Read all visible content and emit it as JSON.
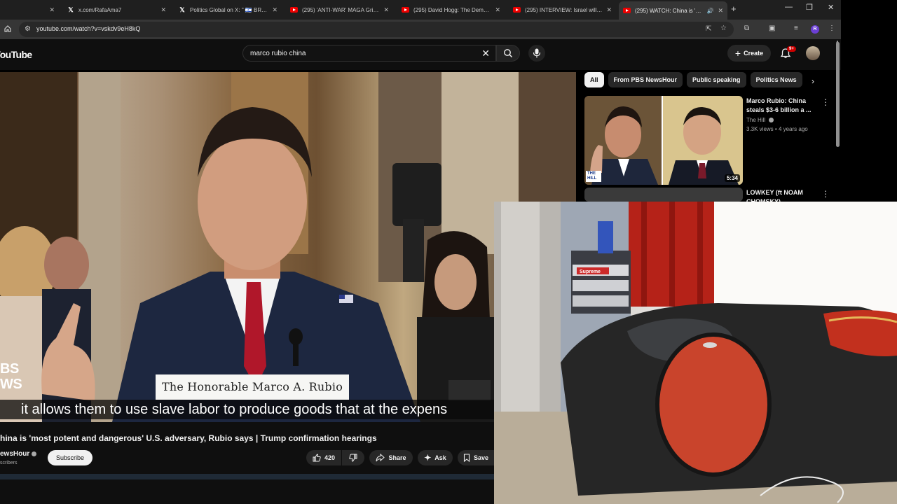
{
  "browser": {
    "tabs": [
      {
        "title": "",
        "icon": "blank-icon",
        "active": false
      },
      {
        "title": "x.com/RafaAma7",
        "icon": "x-logo-icon",
        "active": false
      },
      {
        "title": "Politics Global on X: \" 🇮🇱 BRE…",
        "icon": "x-logo-icon",
        "active": false
      },
      {
        "title": "(295) 'ANTI-WAR' MAGA Grifte…",
        "icon": "youtube-icon",
        "active": false
      },
      {
        "title": "(295) David Hogg: The Democ…",
        "icon": "youtube-icon",
        "active": false
      },
      {
        "title": "(295) INTERVIEW: Israel will ac…",
        "icon": "youtube-icon",
        "active": false
      },
      {
        "title": "(295) WATCH: China is 'mo…",
        "icon": "youtube-icon",
        "active": true
      }
    ],
    "url": "youtube.com/watch?v=vskdv9eH8kQ",
    "profile_initial": "R"
  },
  "youtube": {
    "logo_text": "YouTube",
    "search_query": "marco rubio china",
    "create_label": "Create",
    "notification_badge": "9+"
  },
  "video": {
    "lower_third": "The Honorable Marco A. Rubio",
    "subtitle": "it allows them to use slave labor to produce goods that at the expens",
    "network_bug": "BS\nWS",
    "title": "hina is 'most potent and dangerous' U.S. adversary, Rubio says | Trump confirmation hearings",
    "channel": "ewsHour",
    "subscribers": "scribers",
    "subscribe_label": "Subscribe",
    "likes": "420",
    "share_label": "Share",
    "ask_label": "Ask",
    "save_label": "Save"
  },
  "sidebar": {
    "chips": [
      {
        "label": "All",
        "active": true
      },
      {
        "label": "From PBS NewsHour",
        "active": false
      },
      {
        "label": "Public speaking",
        "active": false
      },
      {
        "label": "Politics News",
        "active": false
      }
    ],
    "recommendations": [
      {
        "title": "Marco Rubio: China steals $3-6 billion a ...",
        "channel": "The Hill",
        "views": "3.3K views",
        "age": "4 years ago",
        "duration": "5:34",
        "thumb_logo": "THE HILL"
      },
      {
        "title": "LOWKEY (ft NOAM CHOMSKY)",
        "channel": "",
        "views": "",
        "age": "",
        "duration": ""
      }
    ]
  },
  "webcam": {
    "box_label": "Supreme"
  },
  "colors": {
    "chrome_bg": "#1f1f1f",
    "toolbar_bg": "#363636",
    "yt_bg": "#0f0f0f",
    "yt_red": "#cc0000",
    "chair_red": "#c9442c",
    "curtain_red": "#b52218"
  }
}
